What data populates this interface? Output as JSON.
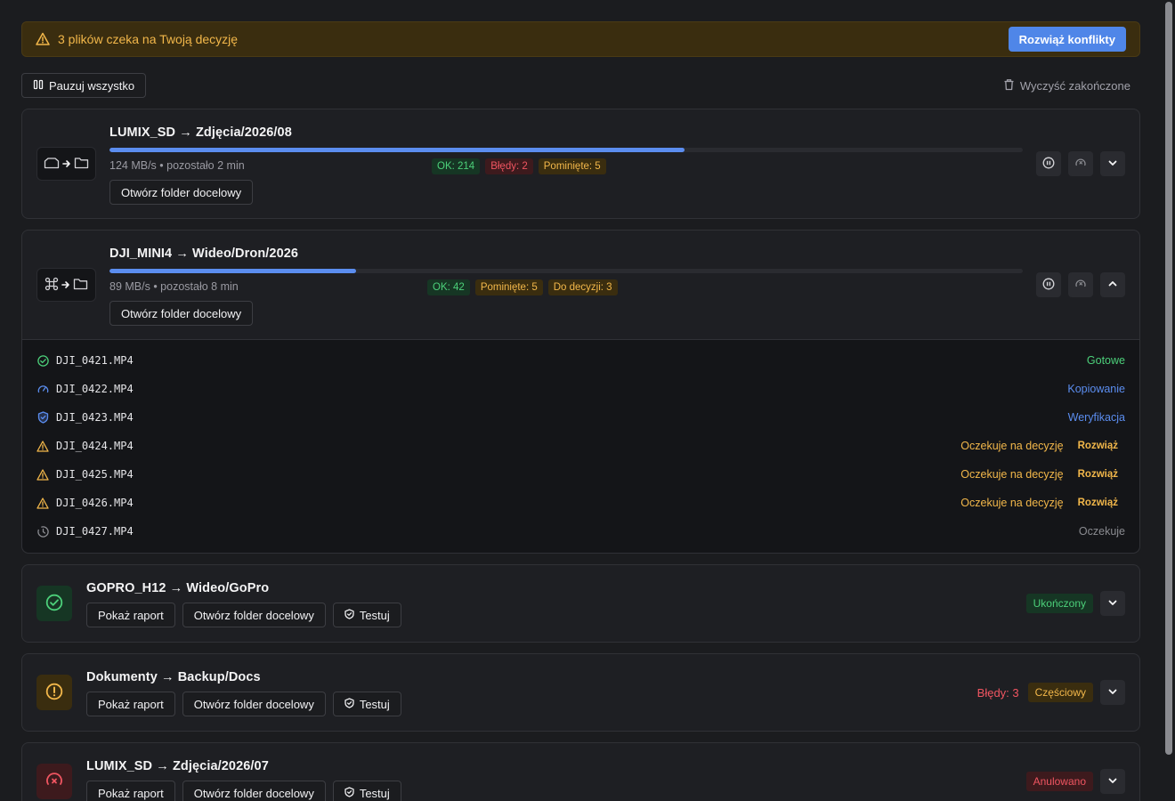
{
  "banner": {
    "message": "3 plików czeka na Twoją decyzję",
    "resolve_label": "Rozwiąż konflikty"
  },
  "toolbar": {
    "pause_all_label": "Pauzuj wszystko",
    "clear_label": "Wyczyść zakończone"
  },
  "jobs": [
    {
      "title": "LUMIX_SD → Zdjęcia/2026/08",
      "progress": 0.63,
      "speed": "124 MB/s • pozostało 2 min",
      "badges": [
        "OK: 214",
        "Błędy: 2",
        "Pominięte: 5"
      ],
      "open_label": "Otwórz folder docelowy"
    },
    {
      "title": "DJI_MINI4 → Wideo/Dron/2026",
      "progress": 0.27,
      "speed": "89 MB/s • pozostało 8 min",
      "badges": [
        "OK: 42",
        "Pominięte: 5",
        "Do decyzji: 3"
      ],
      "open_label": "Otwórz folder docelowy",
      "files": [
        {
          "name": "DJI_0421.MP4",
          "state": "Gotowe"
        },
        {
          "name": "DJI_0422.MP4",
          "state": "Kopiowanie"
        },
        {
          "name": "DJI_0423.MP4",
          "state": "Weryfikacja"
        },
        {
          "name": "DJI_0424.MP4",
          "state": "Oczekuje na decyzję",
          "action": "Rozwiąż"
        },
        {
          "name": "DJI_0425.MP4",
          "state": "Oczekuje na decyzję",
          "action": "Rozwiąż"
        },
        {
          "name": "DJI_0426.MP4",
          "state": "Oczekuje na decyzję",
          "action": "Rozwiąż"
        },
        {
          "name": "DJI_0427.MP4",
          "state": "Oczekuje"
        }
      ]
    },
    {
      "title": "GOPRO_H12 → Wideo/GoPro",
      "report_label": "Pokaż raport",
      "open_label": "Otwórz folder docelowy",
      "test_label": "Testuj",
      "status": "Ukończony"
    },
    {
      "title": "Dokumenty → Backup/Docs",
      "report_label": "Pokaż raport",
      "open_label": "Otwórz folder docelowy",
      "test_label": "Testuj",
      "errors": "Błędy: 3",
      "status": "Częściowy"
    },
    {
      "title": "LUMIX_SD → Zdjęcia/2026/07",
      "report_label": "Pokaż raport",
      "open_label": "Otwórz folder docelowy",
      "test_label": "Testuj",
      "status": "Anulowano"
    }
  ],
  "colors": {
    "accent": "#4f86e8",
    "ok": "#4cd07a",
    "error": "#f05561",
    "warning": "#f2b74a",
    "progress": "#5b8def"
  },
  "icons": {
    "banner": "warning-triangle-icon",
    "pause_all": "pause-icon",
    "clear": "trash-icon",
    "job_source": "camera-icon",
    "job_target": "folder-icon"
  }
}
